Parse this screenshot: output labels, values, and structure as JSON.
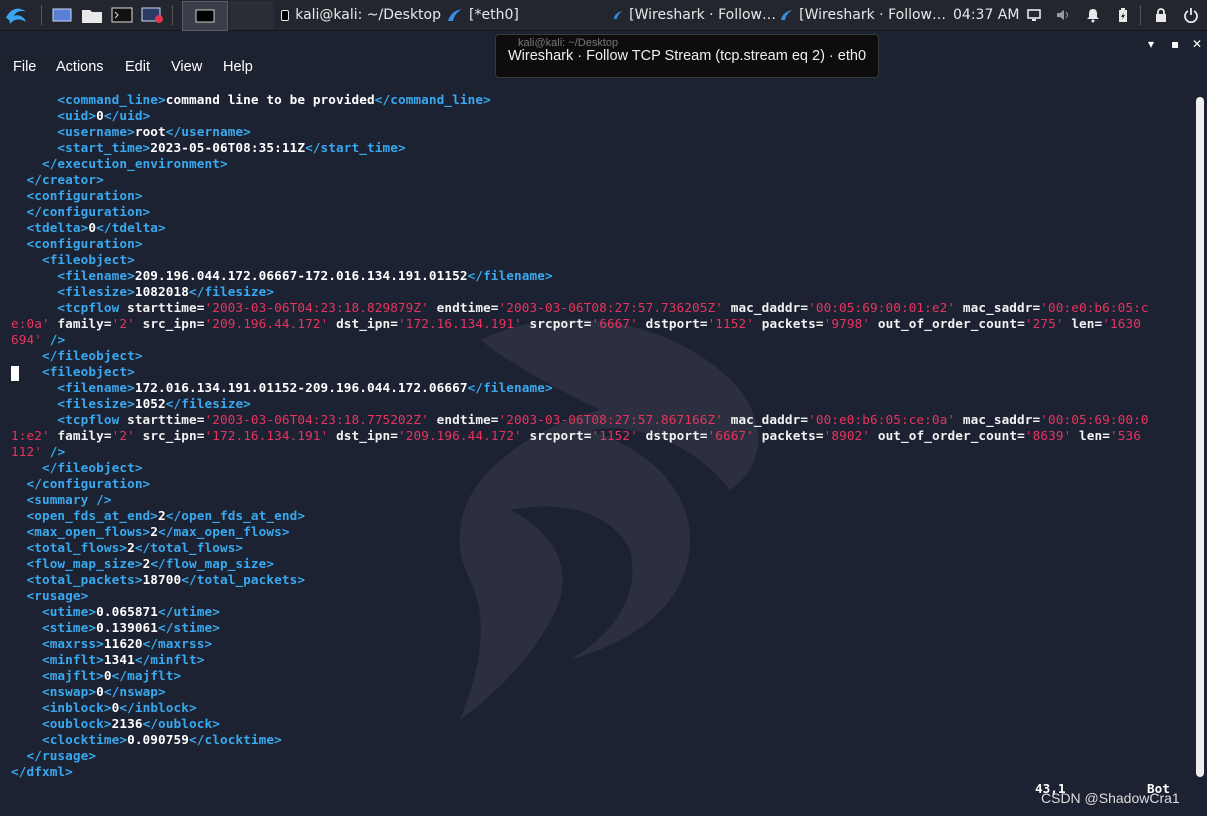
{
  "taskbar": {
    "tasks": [
      {
        "label": "kali@kali: ~/Desktop",
        "icon": "terminal-icon"
      },
      {
        "label": "[*eth0]",
        "icon": "wireshark-icon"
      },
      {
        "label": "[Wireshark · Follow…",
        "icon": "wireshark-icon"
      },
      {
        "label": "[Wireshark · Follow…",
        "icon": "wireshark-icon"
      }
    ],
    "clock": "04:37 AM"
  },
  "window": {
    "menu": [
      "File",
      "Actions",
      "Edit",
      "View",
      "Help"
    ],
    "controls": [
      "▾",
      "▪",
      "✕"
    ]
  },
  "tooltip": {
    "ghost_title": "kali@kali: ~/Desktop",
    "text": "Wireshark · Follow TCP Stream (tcp.stream eq 2) · eth0"
  },
  "terminal": {
    "lines": [
      [
        [
          "t",
          "      <command_line>"
        ],
        [
          "v",
          "command line to be provided"
        ],
        [
          "t",
          "</command_line>"
        ]
      ],
      [
        [
          "t",
          "      <uid>"
        ],
        [
          "v",
          "0"
        ],
        [
          "t",
          "</uid>"
        ]
      ],
      [
        [
          "t",
          "      <username>"
        ],
        [
          "v",
          "root"
        ],
        [
          "t",
          "</username>"
        ]
      ],
      [
        [
          "t",
          "      <start_time>"
        ],
        [
          "v",
          "2023-05-06T08:35:11Z"
        ],
        [
          "t",
          "</start_time>"
        ]
      ],
      [
        [
          "t",
          "    </execution_environment>"
        ]
      ],
      [
        [
          "t",
          "  </creator>"
        ]
      ],
      [
        [
          "t",
          "  <configuration>"
        ]
      ],
      [
        [
          "t",
          "  </configuration>"
        ]
      ],
      [
        [
          "t",
          "  <tdelta>"
        ],
        [
          "v",
          "0"
        ],
        [
          "t",
          "</tdelta>"
        ]
      ],
      [
        [
          "t",
          "  <configuration>"
        ]
      ],
      [
        [
          "t",
          "    <fileobject>"
        ]
      ],
      [
        [
          "t",
          "      <filename>"
        ],
        [
          "v",
          "209.196.044.172.06667-172.016.134.191.01152"
        ],
        [
          "t",
          "</filename>"
        ]
      ],
      [
        [
          "t",
          "      <filesize>"
        ],
        [
          "v",
          "1082018"
        ],
        [
          "t",
          "</filesize>"
        ]
      ],
      [
        [
          "t",
          "      <tcpflow "
        ],
        [
          "a",
          "starttime="
        ],
        [
          "s",
          "'2003-03-06T04:23:18.829879Z'"
        ],
        [
          "a",
          " endtime="
        ],
        [
          "s",
          "'2003-03-06T08:27:57.736205Z'"
        ],
        [
          "a",
          " mac_daddr="
        ],
        [
          "s",
          "'00:05:69:00:01:e2'"
        ],
        [
          "a",
          " mac_saddr="
        ],
        [
          "s",
          "'00:e0:b6:05:c"
        ]
      ],
      [
        [
          "s",
          "e:0a'"
        ],
        [
          "a",
          " family="
        ],
        [
          "s",
          "'2'"
        ],
        [
          "a",
          " src_ipn="
        ],
        [
          "s",
          "'209.196.44.172'"
        ],
        [
          "a",
          " dst_ipn="
        ],
        [
          "s",
          "'172.16.134.191'"
        ],
        [
          "a",
          " srcport="
        ],
        [
          "s",
          "'6667'"
        ],
        [
          "a",
          " dstport="
        ],
        [
          "s",
          "'1152'"
        ],
        [
          "a",
          " packets="
        ],
        [
          "s",
          "'9798'"
        ],
        [
          "a",
          " out_of_order_count="
        ],
        [
          "s",
          "'275'"
        ],
        [
          "a",
          " len="
        ],
        [
          "s",
          "'1630"
        ]
      ],
      [
        [
          "s",
          "694'"
        ],
        [
          "t",
          " />"
        ]
      ],
      [
        [
          "t",
          "    </fileobject>"
        ]
      ],
      [
        [
          "t",
          "    <fileobject>"
        ]
      ],
      [
        [
          "t",
          "      <filename>"
        ],
        [
          "v",
          "172.016.134.191.01152-209.196.044.172.06667"
        ],
        [
          "t",
          "</filename>"
        ]
      ],
      [
        [
          "t",
          "      <filesize>"
        ],
        [
          "v",
          "1052"
        ],
        [
          "t",
          "</filesize>"
        ]
      ],
      [
        [
          "t",
          "      <tcpflow "
        ],
        [
          "a",
          "starttime="
        ],
        [
          "s",
          "'2003-03-06T04:23:18.775202Z'"
        ],
        [
          "a",
          " endtime="
        ],
        [
          "s",
          "'2003-03-06T08:27:57.867166Z'"
        ],
        [
          "a",
          " mac_daddr="
        ],
        [
          "s",
          "'00:e0:b6:05:ce:0a'"
        ],
        [
          "a",
          " mac_saddr="
        ],
        [
          "s",
          "'00:05:69:00:0"
        ]
      ],
      [
        [
          "s",
          "1:e2'"
        ],
        [
          "a",
          " family="
        ],
        [
          "s",
          "'2'"
        ],
        [
          "a",
          " src_ipn="
        ],
        [
          "s",
          "'172.16.134.191'"
        ],
        [
          "a",
          " dst_ipn="
        ],
        [
          "s",
          "'209.196.44.172'"
        ],
        [
          "a",
          " srcport="
        ],
        [
          "s",
          "'1152'"
        ],
        [
          "a",
          " dstport="
        ],
        [
          "s",
          "'6667'"
        ],
        [
          "a",
          " packets="
        ],
        [
          "s",
          "'8902'"
        ],
        [
          "a",
          " out_of_order_count="
        ],
        [
          "s",
          "'8639'"
        ],
        [
          "a",
          " len="
        ],
        [
          "s",
          "'536"
        ]
      ],
      [
        [
          "s",
          "112'"
        ],
        [
          "t",
          " />"
        ]
      ],
      [
        [
          "t",
          "    </fileobject>"
        ]
      ],
      [
        [
          "t",
          "  </configuration>"
        ]
      ],
      [
        [
          "t",
          "  <summary />"
        ]
      ],
      [
        [
          "t",
          "  <open_fds_at_end>"
        ],
        [
          "v",
          "2"
        ],
        [
          "t",
          "</open_fds_at_end>"
        ]
      ],
      [
        [
          "t",
          "  <max_open_flows>"
        ],
        [
          "v",
          "2"
        ],
        [
          "t",
          "</max_open_flows>"
        ]
      ],
      [
        [
          "t",
          "  <total_flows>"
        ],
        [
          "v",
          "2"
        ],
        [
          "t",
          "</total_flows>"
        ]
      ],
      [
        [
          "t",
          "  <flow_map_size>"
        ],
        [
          "v",
          "2"
        ],
        [
          "t",
          "</flow_map_size>"
        ]
      ],
      [
        [
          "t",
          "  <total_packets>"
        ],
        [
          "v",
          "18700"
        ],
        [
          "t",
          "</total_packets>"
        ]
      ],
      [
        [
          "t",
          "  <rusage>"
        ]
      ],
      [
        [
          "t",
          "    <utime>"
        ],
        [
          "v",
          "0.065871"
        ],
        [
          "t",
          "</utime>"
        ]
      ],
      [
        [
          "t",
          "    <stime>"
        ],
        [
          "v",
          "0.139061"
        ],
        [
          "t",
          "</stime>"
        ]
      ],
      [
        [
          "t",
          "    <maxrss>"
        ],
        [
          "v",
          "11620"
        ],
        [
          "t",
          "</maxrss>"
        ]
      ],
      [
        [
          "t",
          "    <minflt>"
        ],
        [
          "v",
          "1341"
        ],
        [
          "t",
          "</minflt>"
        ]
      ],
      [
        [
          "t",
          "    <majflt>"
        ],
        [
          "v",
          "0"
        ],
        [
          "t",
          "</majflt>"
        ]
      ],
      [
        [
          "t",
          "    <nswap>"
        ],
        [
          "v",
          "0"
        ],
        [
          "t",
          "</nswap>"
        ]
      ],
      [
        [
          "t",
          "    <inblock>"
        ],
        [
          "v",
          "0"
        ],
        [
          "t",
          "</inblock>"
        ]
      ],
      [
        [
          "t",
          "    <oublock>"
        ],
        [
          "v",
          "2136"
        ],
        [
          "t",
          "</oublock>"
        ]
      ],
      [
        [
          "t",
          "    <clocktime>"
        ],
        [
          "v",
          "0.090759"
        ],
        [
          "t",
          "</clocktime>"
        ]
      ],
      [
        [
          "t",
          "  </rusage>"
        ]
      ],
      [
        [
          "t",
          "</dfxml>"
        ]
      ]
    ],
    "status_position": "43,1",
    "status_scroll": "Bot"
  },
  "watermark": "CSDN @ShadowCra1"
}
